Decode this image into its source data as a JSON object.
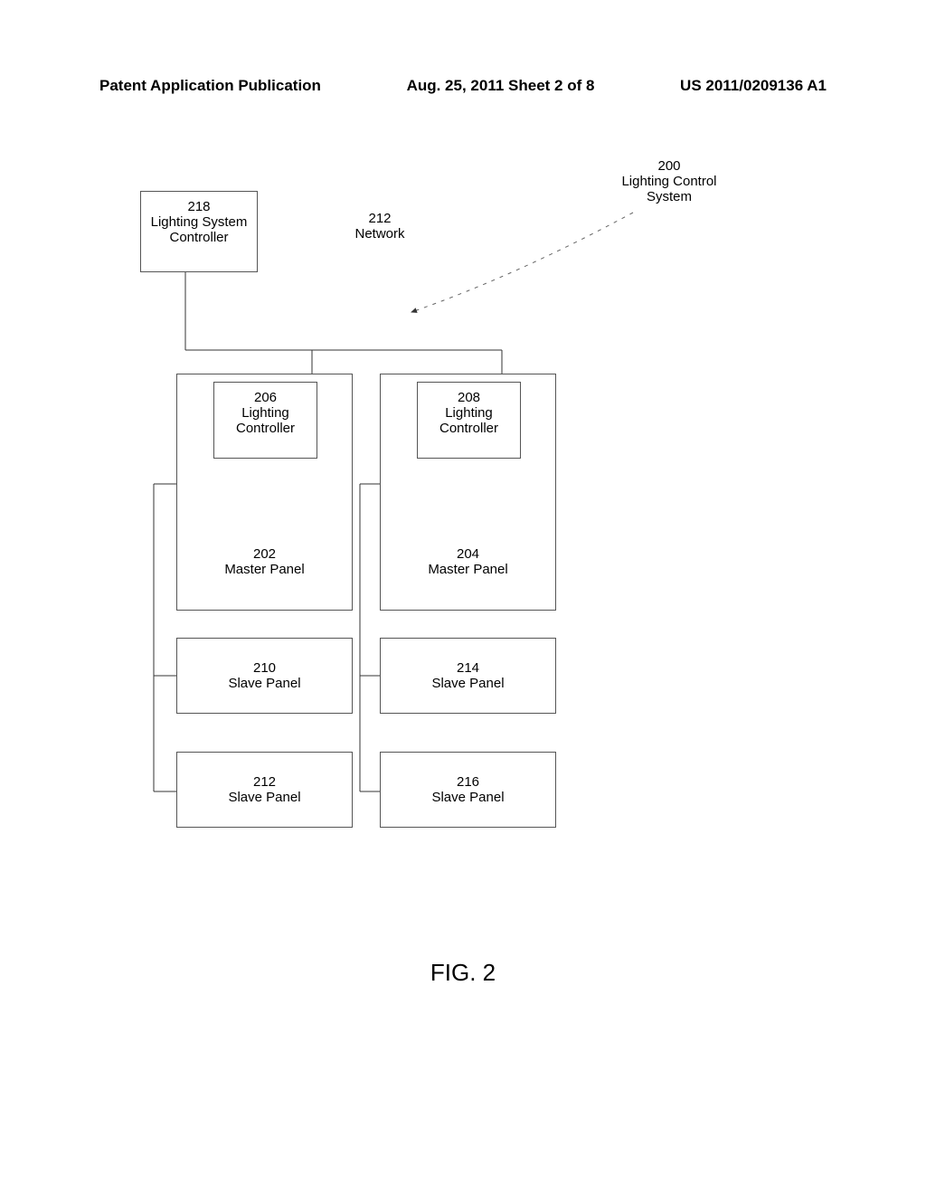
{
  "header": {
    "left": "Patent Application Publication",
    "center": "Aug. 25, 2011  Sheet 2 of 8",
    "right": "US 2011/0209136 A1"
  },
  "labels": {
    "system": {
      "num": "200",
      "text": "Lighting Control System"
    },
    "network": {
      "num": "212",
      "text": "Network"
    },
    "controller_sys": {
      "num": "218",
      "text": "Lighting System Controller"
    },
    "controller_a": {
      "num": "206",
      "text": "Lighting Controller"
    },
    "controller_b": {
      "num": "208",
      "text": "Lighting Controller"
    },
    "master_a": {
      "num": "202",
      "text": "Master Panel"
    },
    "master_b": {
      "num": "204",
      "text": "Master Panel"
    },
    "slave_210": {
      "num": "210",
      "text": "Slave Panel"
    },
    "slave_212": {
      "num": "212",
      "text": "Slave Panel"
    },
    "slave_214": {
      "num": "214",
      "text": "Slave Panel"
    },
    "slave_216": {
      "num": "216",
      "text": "Slave Panel"
    }
  },
  "figure": "FIG. 2"
}
